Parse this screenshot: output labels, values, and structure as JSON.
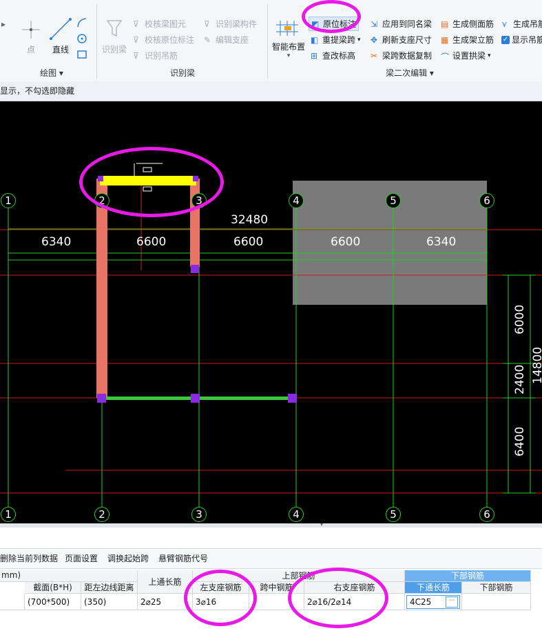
{
  "ribbon": {
    "draw_group": {
      "point_label": "点",
      "line_label": "直线",
      "group_label": "绘图"
    },
    "identify_group": {
      "identify_beam_label": "识别梁",
      "check_beam_elem": "校核梁图元",
      "check_inplace": "校核原位标注",
      "identify_hanger": "识别吊筋",
      "identify_member": "识别梁构件",
      "edit_support": "编辑支座",
      "group_label": "识别梁"
    },
    "edit_group": {
      "smart_layout": "智能布置",
      "inplace_annotation": "原位标注",
      "span_hidden": "重提梁跨",
      "check_elevation": "查改标高",
      "apply_same_name": "应用到同名梁",
      "refresh_support": "刷新支座尺寸",
      "span_copy": "梁跨数据复制",
      "gen_side_rebar": "生成侧面筋",
      "gen_erect_rebar": "生成架立筋",
      "set_arch": "设置拱梁",
      "gen_hanger": "生成吊筋",
      "show_hanger": "显示吊筋",
      "group_label": "梁二次编辑"
    }
  },
  "status_text": "显示，不勾选即隐藏",
  "canvas": {
    "axis_labels": [
      "1",
      "2",
      "3",
      "4",
      "5",
      "6"
    ],
    "total_dim": "32480",
    "span_dims": [
      "6340",
      "6600",
      "6600",
      "6600",
      "6340"
    ],
    "vert_dims": [
      "6000",
      "2400",
      "6400"
    ],
    "vert_total": "14800"
  },
  "toolbar2": {
    "delete_col": "删除当前列数据",
    "page_setup": "页面设置",
    "swap_start": "调换起始跨",
    "cantilever_code": "悬臂钢筋代号"
  },
  "table": {
    "unit_header": "mm)",
    "top_rebar_header": "上部钢筋",
    "bottom_rebar_header": "下部钢筋",
    "col_section": "截面(B*H)",
    "col_left_dist": "距左边线距离",
    "col_top_through": "上通长筋",
    "col_left_support": "左支座钢筋",
    "col_mid_span": "跨中钢筋",
    "col_right_support": "右支座钢筋",
    "col_bottom_through": "下通长筋",
    "col_bottom_rebar": "下部钢筋",
    "row": {
      "section": "(700*500)",
      "left_dist": "(350)",
      "top_through": "2⌀25",
      "left_support": "3⌀16",
      "mid_span": "",
      "right_support": "2⌀16/2⌀14",
      "bottom_through": "4C25",
      "bottom_rebar": ""
    }
  },
  "colors": {
    "annotation_oval": "#e81ae6",
    "beam_yellow": "#ffff00",
    "beam_green": "#3ec43e",
    "column_salmon": "#e87468",
    "grid_red": "#d11c1c",
    "dim_green": "#1fd11f",
    "support_purple": "#8a2be2"
  }
}
